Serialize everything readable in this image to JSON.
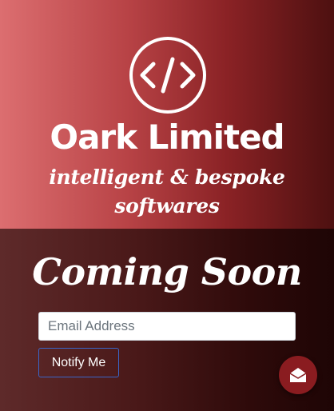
{
  "hero": {
    "logo_icon": "code-brackets-icon",
    "company_name": "Oark Limited",
    "tagline": "intelligent & bespoke softwares"
  },
  "signup": {
    "heading": "Coming Soon",
    "email_placeholder": "Email Address",
    "notify_label": "Notify Me"
  },
  "contact_button": {
    "icon": "envelope-open-icon"
  },
  "colors": {
    "hero_gradient_start": "#dc6e70",
    "hero_gradient_end": "#4d1010",
    "lower_background": "#3a1212",
    "fab_background": "#8a1c20",
    "notify_border": "#3a66c9"
  }
}
